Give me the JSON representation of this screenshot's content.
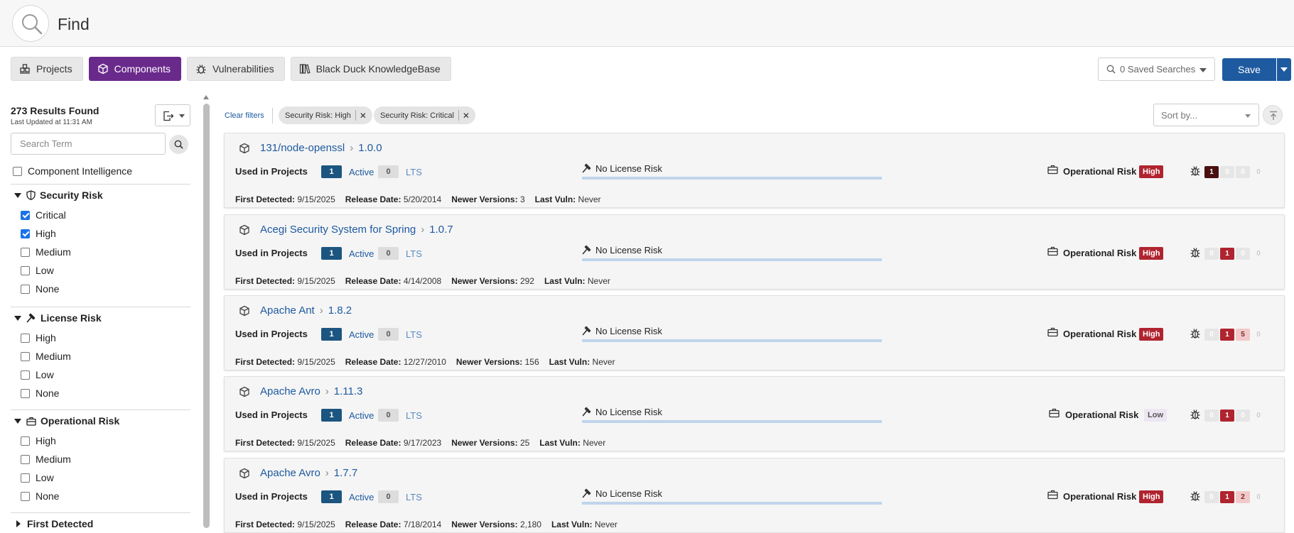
{
  "header": {
    "title": "Find"
  },
  "tabs": [
    {
      "label": "Projects",
      "icon": "projects-icon",
      "active": false
    },
    {
      "label": "Components",
      "icon": "component-box-icon",
      "active": true
    },
    {
      "label": "Vulnerabilities",
      "icon": "bug-icon",
      "active": false
    },
    {
      "label": "Black Duck KnowledgeBase",
      "icon": "library-icon",
      "active": false
    }
  ],
  "toolbar": {
    "saved_searches_label": "0 Saved Searches",
    "save_label": "Save"
  },
  "sidebar": {
    "results_found": "273 Results Found",
    "last_updated": "Last Updated at 11:31 AM",
    "search_placeholder": "Search Term",
    "component_intelligence_label": "Component Intelligence",
    "facets": [
      {
        "title": "Security Risk",
        "icon": "shield-icon",
        "expanded": true,
        "options": [
          {
            "label": "Critical",
            "checked": true
          },
          {
            "label": "High",
            "checked": true
          },
          {
            "label": "Medium",
            "checked": false
          },
          {
            "label": "Low",
            "checked": false
          },
          {
            "label": "None",
            "checked": false
          }
        ]
      },
      {
        "title": "License Risk",
        "icon": "gavel-icon",
        "expanded": true,
        "options": [
          {
            "label": "High",
            "checked": false
          },
          {
            "label": "Medium",
            "checked": false
          },
          {
            "label": "Low",
            "checked": false
          },
          {
            "label": "None",
            "checked": false
          }
        ]
      },
      {
        "title": "Operational Risk",
        "icon": "briefcase-icon",
        "expanded": true,
        "options": [
          {
            "label": "High",
            "checked": false
          },
          {
            "label": "Medium",
            "checked": false
          },
          {
            "label": "Low",
            "checked": false
          },
          {
            "label": "None",
            "checked": false
          }
        ]
      },
      {
        "title": "First Detected",
        "icon": "",
        "expanded": false,
        "options": []
      }
    ]
  },
  "filters": {
    "clear_label": "Clear filters",
    "chips": [
      {
        "label": "Security Risk: High"
      },
      {
        "label": "Security Risk: Critical"
      }
    ],
    "sort_placeholder": "Sort by..."
  },
  "labels": {
    "used_in_projects": "Used in Projects",
    "active": "Active",
    "lts": "LTS",
    "operational_risk": "Operational Risk",
    "first_detected": "First Detected:",
    "release_date": "Release Date:",
    "newer_versions": "Newer Versions:",
    "last_vuln": "Last Vuln:"
  },
  "results": [
    {
      "name": "131/node-openssl",
      "version": "1.0.0",
      "active_count": "1",
      "lts_count": "0",
      "license_risk": "No License Risk",
      "operational_risk": "High",
      "vulns": {
        "critical": "1",
        "high": "0",
        "medium": "0",
        "low": "0"
      },
      "first_detected": "9/15/2025",
      "release_date": "5/20/2014",
      "newer_versions": "3",
      "last_vuln": "Never"
    },
    {
      "name": "Acegi Security System for Spring",
      "version": "1.0.7",
      "active_count": "1",
      "lts_count": "0",
      "license_risk": "No License Risk",
      "operational_risk": "High",
      "vulns": {
        "critical": "0",
        "high": "1",
        "medium": "0",
        "low": "0"
      },
      "first_detected": "9/15/2025",
      "release_date": "4/14/2008",
      "newer_versions": "292",
      "last_vuln": "Never"
    },
    {
      "name": "Apache Ant",
      "version": "1.8.2",
      "active_count": "1",
      "lts_count": "0",
      "license_risk": "No License Risk",
      "operational_risk": "High",
      "vulns": {
        "critical": "0",
        "high": "1",
        "medium": "5",
        "low": "0"
      },
      "first_detected": "9/15/2025",
      "release_date": "12/27/2010",
      "newer_versions": "156",
      "last_vuln": "Never"
    },
    {
      "name": "Apache Avro",
      "version": "1.11.3",
      "active_count": "1",
      "lts_count": "0",
      "license_risk": "No License Risk",
      "operational_risk": "Low",
      "vulns": {
        "critical": "0",
        "high": "1",
        "medium": "0",
        "low": "0"
      },
      "first_detected": "9/15/2025",
      "release_date": "9/17/2023",
      "newer_versions": "25",
      "last_vuln": "Never"
    },
    {
      "name": "Apache Avro",
      "version": "1.7.7",
      "active_count": "1",
      "lts_count": "0",
      "license_risk": "No License Risk",
      "operational_risk": "High",
      "vulns": {
        "critical": "0",
        "high": "1",
        "medium": "2",
        "low": "0"
      },
      "first_detected": "9/15/2025",
      "release_date": "7/18/2014",
      "newer_versions": "2,180",
      "last_vuln": "Never"
    }
  ],
  "colors": {
    "accent_purple": "#6a2a8c",
    "primary_blue": "#1e5aa0",
    "risk_high": "#b02430",
    "risk_critical": "#4a1010"
  }
}
